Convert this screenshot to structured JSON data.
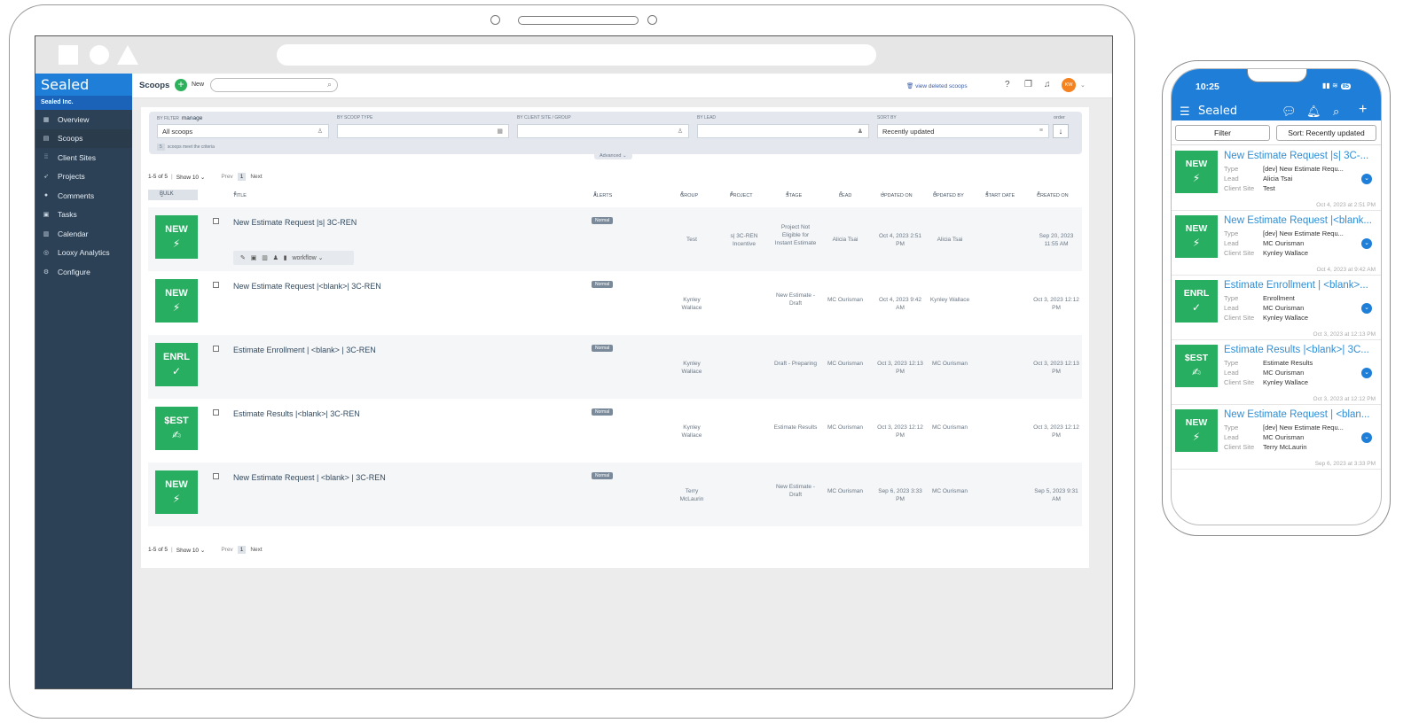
{
  "app": {
    "brand": "Sealed",
    "org": "Sealed Inc."
  },
  "sidebar": {
    "items": [
      {
        "label": "Overview",
        "icon": "grid-icon"
      },
      {
        "label": "Scoops",
        "icon": "scoops-icon"
      },
      {
        "label": "Client Sites",
        "icon": "client-sites-icon"
      },
      {
        "label": "Projects",
        "icon": "rocket-icon"
      },
      {
        "label": "Comments",
        "icon": "comments-icon"
      },
      {
        "label": "Tasks",
        "icon": "tasks-icon"
      },
      {
        "label": "Calendar",
        "icon": "calendar-icon"
      },
      {
        "label": "Looxy Analytics",
        "icon": "analytics-icon"
      },
      {
        "label": "Configure",
        "icon": "configure-icon"
      }
    ]
  },
  "header": {
    "title": "Scoops",
    "new_label": "New",
    "view_deleted": "view deleted scoops",
    "avatar": "KW"
  },
  "filters": {
    "by_filter_label": "BY FILTER",
    "manage": "manage",
    "by_filter_value": "All scoops",
    "by_scoop_type_label": "BY SCOOP TYPE",
    "by_client_label": "BY CLIENT SITE / GROUP",
    "by_lead_label": "BY LEAD",
    "sort_by_label": "SORT BY",
    "sort_by_value": "Recently updated",
    "order_label": "order",
    "criteria_count": "5",
    "criteria_text": "scoops meet the criteria",
    "advanced": "Advanced"
  },
  "pager": {
    "range": "1-5 of 5",
    "show": "Show 10",
    "prev": "Prev",
    "page": "1",
    "next": "Next"
  },
  "table": {
    "bulk": "BULK",
    "columns": [
      "TITLE",
      "ALERTS",
      "GROUP",
      "PROJECT",
      "STAGE",
      "LEAD",
      "UPDATED ON",
      "UPDATED BY",
      "START DATE",
      "CREATED ON"
    ],
    "workflow": "workflow",
    "rows": [
      {
        "tile": "NEW",
        "title": "New Estimate Request |s| 3C-REN",
        "alert": "Normal",
        "group": "Test",
        "project": "s| 3C-REN Incentive",
        "stage": "Project Not Eligible for Instant Estimate",
        "lead": "Alicia Tsai",
        "updated_on": "Oct 4, 2023 2:51 PM",
        "updated_by": "Alicia Tsai",
        "created_on": "Sep 20, 2023 11:55 AM"
      },
      {
        "tile": "NEW",
        "title": "New Estimate Request |<blank>| 3C-REN",
        "alert": "Normal",
        "group": "Kynley Wallace",
        "project": "",
        "stage": "New Estimate - Draft",
        "lead": "MC Ourisman",
        "updated_on": "Oct 4, 2023 9:42 AM",
        "updated_by": "Kynley Wallace",
        "created_on": "Oct 3, 2023 12:12 PM"
      },
      {
        "tile": "ENRL",
        "title": "Estimate Enrollment | <blank> | 3C-REN",
        "alert": "Normal",
        "group": "Kynley Wallace",
        "project": "",
        "stage": "Draft - Preparing",
        "lead": "MC Ourisman",
        "updated_on": "Oct 3, 2023 12:13 PM",
        "updated_by": "MC Ourisman",
        "created_on": "Oct 3, 2023 12:13 PM"
      },
      {
        "tile": "$EST",
        "title": "Estimate Results |<blank>| 3C-REN",
        "alert": "Normal",
        "group": "Kynley Wallace",
        "project": "",
        "stage": "Estimate Results",
        "lead": "MC Ourisman",
        "updated_on": "Oct 3, 2023 12:12 PM",
        "updated_by": "MC Ourisman",
        "created_on": "Oct 3, 2023 12:12 PM"
      },
      {
        "tile": "NEW",
        "title": "New Estimate Request | <blank> | 3C-REN",
        "alert": "Normal",
        "group": "Terry McLaurin",
        "project": "",
        "stage": "New Estimate - Draft",
        "lead": "MC Ourisman",
        "updated_on": "Sep 6, 2023 3:33 PM",
        "updated_by": "MC Ourisman",
        "created_on": "Sep 5, 2023 9:31 AM"
      }
    ]
  },
  "phone": {
    "time": "10:25",
    "battery": "85",
    "brand": "Sealed",
    "filter": "Filter",
    "sort": "Sort: Recently updated",
    "labels": {
      "type": "Type",
      "lead": "Lead",
      "client": "Client Site"
    },
    "cards": [
      {
        "tile": "NEW",
        "title": "New Estimate Request |s| 3C-...",
        "type": "[dev] New Estimate Requ...",
        "lead": "Alicia Tsai",
        "client": "Test",
        "ts": "Oct 4, 2023 at 2:51 PM"
      },
      {
        "tile": "NEW",
        "title": "New Estimate Request |<blank...",
        "type": "[dev] New Estimate Requ...",
        "lead": "MC Ourisman",
        "client": "Kynley Wallace",
        "ts": "Oct 4, 2023 at 9:42 AM"
      },
      {
        "tile": "ENRL",
        "title": "Estimate Enrollment | <blank>...",
        "type": "Enrollment",
        "lead": "MC Ourisman",
        "client": "Kynley Wallace",
        "ts": "Oct 3, 2023 at 12:13 PM"
      },
      {
        "tile": "$EST",
        "title": "Estimate Results |<blank>| 3C...",
        "type": "Estimate Results",
        "lead": "MC Ourisman",
        "client": "Kynley Wallace",
        "ts": "Oct 3, 2023 at 12:12 PM"
      },
      {
        "tile": "NEW",
        "title": "New Estimate Request | <blan...",
        "type": "[dev] New Estimate Requ...",
        "lead": "MC Ourisman",
        "client": "Terry McLaurin",
        "ts": "Sep 6, 2023 at 3:33 PM"
      }
    ]
  },
  "colors": {
    "brand_blue": "#1f7fd8",
    "sidebar": "#2c4155",
    "tile_green": "#27ae60",
    "avatar_orange": "#f58220"
  }
}
